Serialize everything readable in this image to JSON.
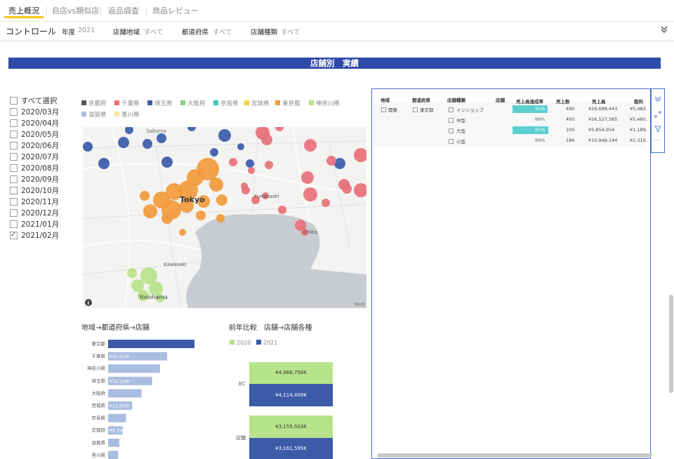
{
  "tabs": [
    "売上概況",
    "自店vs類似店",
    "返品調査",
    "商品レビュー"
  ],
  "control": {
    "title": "コントロール",
    "filters": [
      {
        "label": "年度",
        "value": "2021"
      },
      {
        "label": "店舗地域",
        "value": "すべて"
      },
      {
        "label": "都道府県",
        "value": "すべて"
      },
      {
        "label": "店舗種類",
        "value": "すべて"
      }
    ]
  },
  "banner": "店舗別　実績",
  "slicer": {
    "items": [
      {
        "label": "すべて選択",
        "checked": false
      },
      {
        "label": "2020/03月",
        "checked": false
      },
      {
        "label": "2020/04月",
        "checked": false
      },
      {
        "label": "2020/05月",
        "checked": false
      },
      {
        "label": "2020/06月",
        "checked": false
      },
      {
        "label": "2020/07月",
        "checked": false
      },
      {
        "label": "2020/08月",
        "checked": false
      },
      {
        "label": "2020/09月",
        "checked": false
      },
      {
        "label": "2020/10月",
        "checked": false
      },
      {
        "label": "2020/11月",
        "checked": false
      },
      {
        "label": "2020/12月",
        "checked": false
      },
      {
        "label": "2021/01月",
        "checked": false
      },
      {
        "label": "2021/02月",
        "checked": true
      }
    ]
  },
  "map_legend": [
    {
      "label": "京都府",
      "color": "#555555"
    },
    {
      "label": "千葉県",
      "color": "#e8707a"
    },
    {
      "label": "埼玉県",
      "color": "#3b5ba9"
    },
    {
      "label": "大阪府",
      "color": "#88cc88"
    },
    {
      "label": "奈良県",
      "color": "#3cc6c0"
    },
    {
      "label": "宮城県",
      "color": "#f2d24b"
    },
    {
      "label": "東京都",
      "color": "#f39a3c"
    },
    {
      "label": "神奈川県",
      "color": "#b7e38a"
    },
    {
      "label": "滋賀県",
      "color": "#a9bde0"
    },
    {
      "label": "香川県",
      "color": "#f4e7a1"
    }
  ],
  "map_labels": {
    "saitama": "Saitama",
    "tokyo": "Tokyo",
    "funabashi": "Funabashi",
    "chiba": "Chiba",
    "kawasaki": "Kawasaki",
    "yokohama": "Yokohama",
    "attribution": "Mob",
    "info": "i"
  },
  "bar_chart": {
    "title": "地域→都道府県→店舗",
    "categories": [
      "東京都",
      "千葉県",
      "神奈川県",
      "埼玉県",
      "大阪府",
      "宮城県",
      "奈良県",
      "京都府",
      "滋賀県",
      "香川県"
    ],
    "values": [
      155,
      106,
      93,
      79,
      60,
      43,
      32,
      26,
      20,
      18
    ],
    "value_labels": [
      "",
      "¥42,553K",
      "",
      "¥34,119K",
      "",
      "¥14,250K",
      "",
      "¥9,756K",
      "",
      ""
    ]
  },
  "cmp_chart": {
    "title": "前年比較　店舗→店舗各種",
    "legend": [
      {
        "label": "2020",
        "color": "#b7e38a"
      },
      {
        "label": "2021",
        "color": "#3b5ba9"
      }
    ],
    "groups": [
      {
        "label": "EC",
        "v2020": "¥4,066,756K",
        "v2021": "¥4,114,409K"
      },
      {
        "label": "店舗",
        "v2020": "¥3,155,503K",
        "v2021": "¥3,161,595K"
      }
    ]
  },
  "table": {
    "headers": [
      "地域",
      "都道府県",
      "店舗種類",
      "店舗",
      "売上高達成率",
      "売上数",
      "売上高",
      "粗利"
    ],
    "region": "関東",
    "pref": "東京都",
    "rows": [
      {
        "type": "インショップ",
        "rate": "91%",
        "rate_num": 91,
        "count": "490",
        "sales": "¥24,688,443",
        "gross": "¥5,482,"
      },
      {
        "type": "中型",
        "rate": "88%",
        "rate_num": 0,
        "count": "493",
        "sales": "¥26,527,565",
        "gross": "¥5,480,"
      },
      {
        "type": "大型",
        "rate": "92%",
        "rate_num": 92,
        "count": "105",
        "sales": "¥5,854,054",
        "gross": "¥1,189,"
      },
      {
        "type": "小型",
        "rate": "89%",
        "rate_num": 0,
        "count": "186",
        "sales": "¥10,948,144",
        "gross": "¥2,310,"
      }
    ]
  }
}
